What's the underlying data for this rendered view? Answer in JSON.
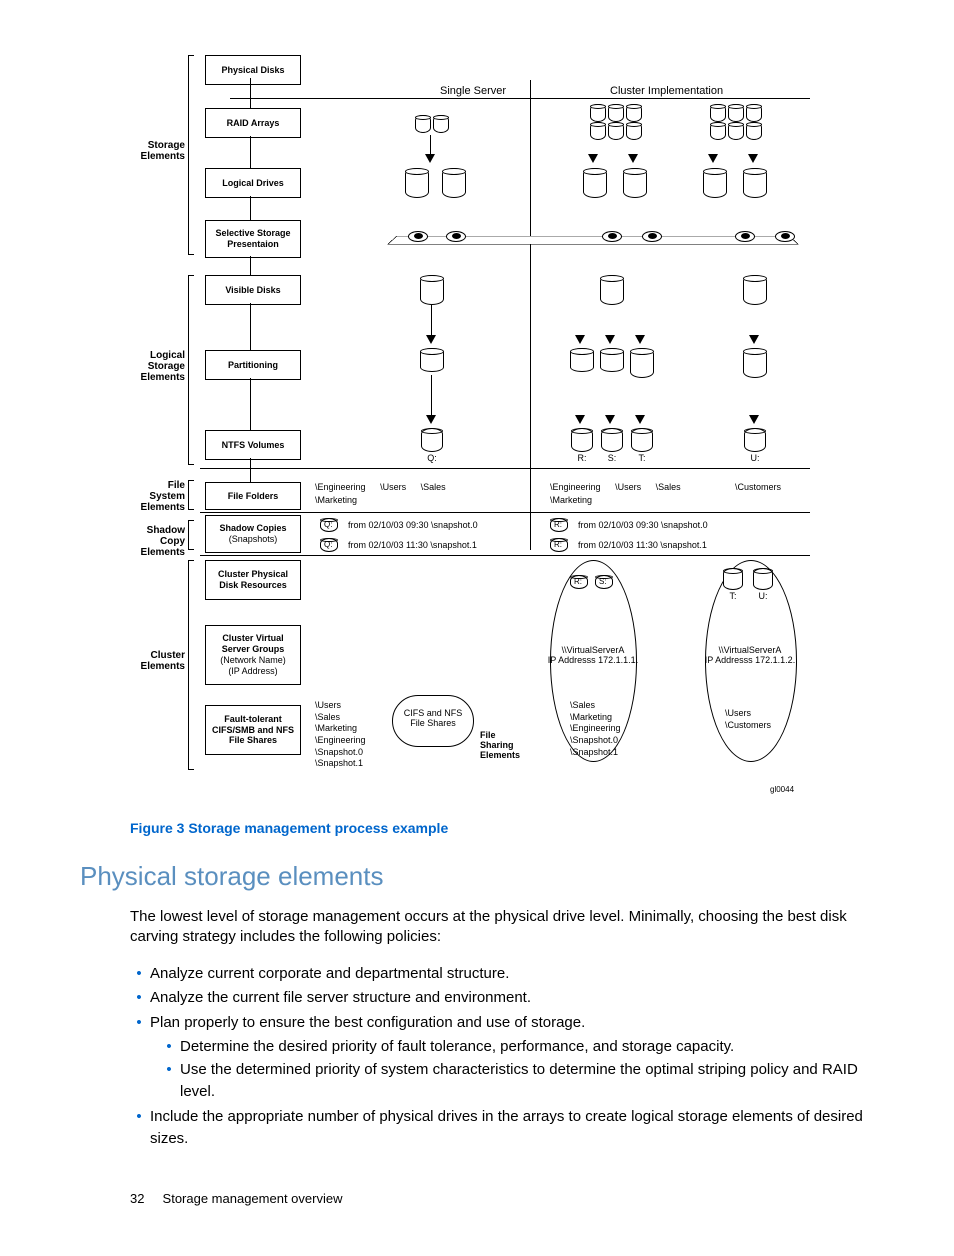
{
  "diagram": {
    "col_headers": {
      "single": "Single Server",
      "cluster": "Cluster Implementation"
    },
    "sections": {
      "storage": "Storage\nElements",
      "logical": "Logical\nStorage\nElements",
      "file_system": "File\nSystem\nElements",
      "shadow": "Shadow Copy\nElements",
      "cluster": "Cluster\nElements"
    },
    "row_boxes": {
      "physical_disks": "Physical Disks",
      "raid_arrays": "RAID Arrays",
      "logical_drives": "Logical Drives",
      "ssp": "Selective Storage Presentaion",
      "visible_disks": "Visible Disks",
      "partitioning": "Partitioning",
      "ntfs_volumes": "NTFS Volumes",
      "file_folders": "File Folders",
      "shadow_copies": "Shadow Copies",
      "shadow_sub": "(Snapshots)",
      "cluster_disk": "Cluster Physical Disk Resources",
      "cluster_vsg": "Cluster Virtual Server Groups",
      "cluster_vsg_sub1": "(Network Name)",
      "cluster_vsg_sub2": "(IP Address)",
      "ft_shares": "Fault-tolerant CIFS/SMB and NFS File Shares"
    },
    "volumes": {
      "q": "Q:",
      "r": "R:",
      "s": "S:",
      "t": "T:",
      "u": "U:"
    },
    "folders_single": [
      "\\Engineering",
      "\\Users",
      "\\Sales"
    ],
    "folders_single2": [
      "\\Marketing"
    ],
    "folders_cluster_left": [
      "\\Engineering",
      "\\Users",
      "\\Sales"
    ],
    "folders_cluster_left2": [
      "\\Marketing"
    ],
    "folders_cluster_right": [
      "\\Customers"
    ],
    "snap_disk_labels": {
      "q": "Q:",
      "r": "R:"
    },
    "snapshots": {
      "s0": "from 02/10/03 09:30 \\snapshot.0",
      "s1": "from 02/10/03 11:30 \\snapshot.1"
    },
    "vservers": {
      "a": {
        "name": "\\\\VirtualServerA",
        "ip": "IP Addresss 172.1.1.1."
      },
      "b": {
        "name": "\\\\VirtualServerA",
        "ip": "IP Addresss 172.1.1.2."
      }
    },
    "cifs_nfs_label": "CIFS and NFS\nFile Shares",
    "file_sharing_label": "File\nSharing\nElements",
    "shares_single": [
      "\\Users",
      "\\Sales",
      "\\Marketing",
      "\\Engineering",
      "\\Snapshot.0",
      "\\Snapshot.1"
    ],
    "shares_cluster_left": [
      "\\Sales",
      "\\Marketing",
      "\\Engineering",
      "\\Snapshot.0",
      "\\Snapshot.1"
    ],
    "shares_cluster_right": [
      "\\Users",
      "\\Customers"
    ],
    "image_code": "gl0044"
  },
  "figure_caption": "Figure 3 Storage management process example",
  "section_heading": "Physical storage elements",
  "intro_paragraph": "The lowest level of storage management occurs at the physical drive level. Minimally, choosing the best disk carving strategy includes the following policies:",
  "bullets": {
    "b1": "Analyze current corporate and departmental structure.",
    "b2": "Analyze the current file server structure and environment.",
    "b3": "Plan properly to ensure the best configuration and use of storage.",
    "b3a": "Determine the desired priority of fault tolerance, performance, and storage capacity.",
    "b3b": "Use the determined priority of system characteristics to determine the optimal striping policy and RAID level.",
    "b4": "Include the appropriate number of physical drives in the arrays to create logical storage elements of desired sizes."
  },
  "footer": {
    "page_num": "32",
    "title": "Storage management overview"
  }
}
